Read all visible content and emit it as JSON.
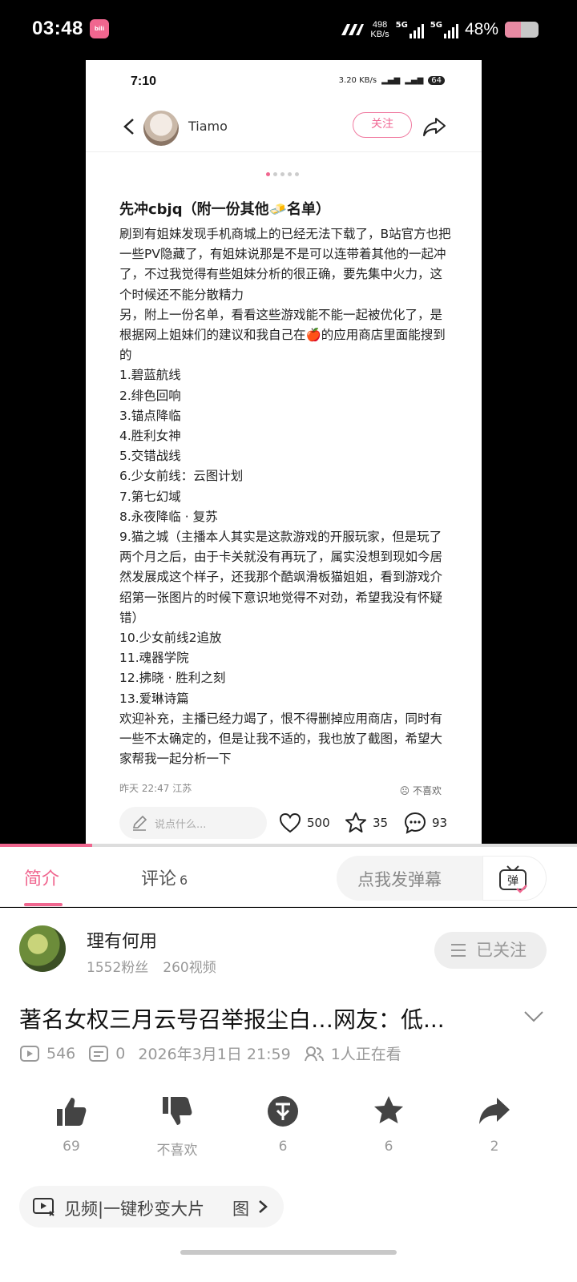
{
  "status_bar": {
    "time": "03:48",
    "net_speed_value": "498",
    "net_speed_unit": "KB/s",
    "sim1": "5G",
    "sim2": "5G",
    "battery": "48%"
  },
  "inner_screenshot": {
    "status_time": "7:10",
    "status_speed": "3.20 KB/s",
    "status_battery": "64",
    "author": "Tiamo",
    "follow_label": "关注",
    "post_title": "先冲cbjq（附一份其他🧈名单）",
    "body_lines": [
      "刷到有姐妹发现手机商城上的已经无法下载了，B站官方也把一些PV隐藏了，有姐妹说那是不是可以连带着其他的一起冲了，不过我觉得有些姐妹分析的很正确，要先集中火力，这个时候还不能分散精力",
      "另，附上一份名单，看看这些游戏能不能一起被优化了，是根据网上姐妹们的建议和我自己在🍎的应用商店里面能搜到的",
      "1.碧蓝航线",
      "2.绯色回响",
      "3.锚点降临",
      "4.胜利女神",
      "5.交错战线",
      "6.少女前线：云图计划",
      "7.第七幻域",
      "8.永夜降临 · 复苏",
      "9.猫之城（主播本人其实是这款游戏的开服玩家，但是玩了两个月之后，由于卡关就没有再玩了，属实没想到现如今居然发展成这个样子，还我那个酷飒滑板猫姐姐，看到游戏介绍第一张图片的时候下意识地觉得不对劲，希望我没有怀疑错）",
      "10.少女前线2追放",
      "11.魂器学院",
      "12.拂晓 · 胜利之刻",
      "13.爱琳诗篇",
      "欢迎补充，主播已经力竭了，恨不得删掉应用商店，同时有一些不太确定的，但是让我不适的，我也放了截图，希望大家帮我一起分析一下"
    ],
    "post_time_location": "昨天 22:47 江苏",
    "dislike_label": "不喜欢",
    "comment_placeholder": "说点什么...",
    "likes": "500",
    "stars": "35",
    "comments": "93"
  },
  "playback_progress": 0.16,
  "tabs": {
    "intro": "简介",
    "comments": "评论",
    "comments_count": "6",
    "danmaku_placeholder": "点我发弹幕",
    "danmaku_button": "弹"
  },
  "uploader": {
    "name": "理有何用",
    "fans": "1552粉丝",
    "videos": "260视频",
    "followed_label": "已关注"
  },
  "video": {
    "title": "著名女权三月云号召举报尘白…网友：低...",
    "views": "546",
    "danmaku_count": "0",
    "date": "2026年3月1日 21:59",
    "watching": "1人正在看"
  },
  "actions": {
    "like": "69",
    "dislike": "不喜欢",
    "coin": "6",
    "favorite": "6",
    "share": "2"
  },
  "promo": {
    "text": "见频|一键秒变大片",
    "suffix": "图"
  },
  "colors": {
    "accent": "#f0668f",
    "muted": "#999999"
  }
}
